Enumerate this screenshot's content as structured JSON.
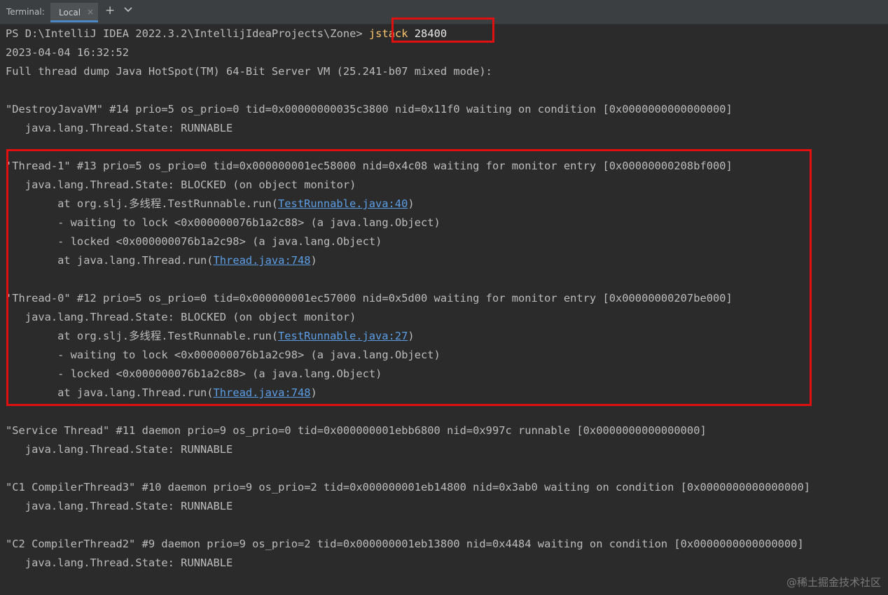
{
  "tabbar": {
    "title": "Terminal:",
    "tab_label": "Local",
    "tab_close": "×",
    "add_label": "+"
  },
  "terminal": {
    "prompt": "PS D:\\IntelliJ IDEA 2022.3.2\\IntellijIdeaProjects\\Zone> ",
    "command": "jstack",
    "command_arg": " 28400",
    "timestamp": "2023-04-04 16:32:52",
    "dump_header": "Full thread dump Java HotSpot(TM) 64-Bit Server VM (25.241-b07 mixed mode):",
    "destroy_header": "\"DestroyJavaVM\" #14 prio=5 os_prio=0 tid=0x00000000035c3800 nid=0x11f0 waiting on condition [0x0000000000000000]",
    "destroy_state": "   java.lang.Thread.State: RUNNABLE",
    "t1_header": "'Thread-1\" #13 prio=5 os_prio=0 tid=0x000000001ec58000 nid=0x4c08 waiting for monitor entry [0x00000000208bf000]",
    "t1_state": "   java.lang.Thread.State: BLOCKED (on object monitor)",
    "t1_at1_pre": "        at org.slj.多线程.TestRunnable.run(",
    "t1_at1_link": "TestRunnable.java:40",
    "t1_at1_post": ")",
    "t1_wait": "        - waiting to lock <0x000000076b1a2c88> (a java.lang.Object)",
    "t1_lock": "        - locked <0x000000076b1a2c98> (a java.lang.Object)",
    "t1_at2_pre": "        at java.lang.Thread.run(",
    "t1_at2_link": "Thread.java:748",
    "t1_at2_post": ")",
    "t0_header": "'Thread-0\" #12 prio=5 os_prio=0 tid=0x000000001ec57000 nid=0x5d00 waiting for monitor entry [0x00000000207be000]",
    "t0_state": "   java.lang.Thread.State: BLOCKED (on object monitor)",
    "t0_at1_pre": "        at org.slj.多线程.TestRunnable.run(",
    "t0_at1_link": "TestRunnable.java:27",
    "t0_at1_post": ")",
    "t0_wait": "        - waiting to lock <0x000000076b1a2c98> (a java.lang.Object)",
    "t0_lock": "        - locked <0x000000076b1a2c88> (a java.lang.Object)",
    "t0_at2_pre": "        at java.lang.Thread.run(",
    "t0_at2_link": "Thread.java:748",
    "t0_at2_post": ")",
    "service_header": "\"Service Thread\" #11 daemon prio=9 os_prio=0 tid=0x000000001ebb6800 nid=0x997c runnable [0x0000000000000000]",
    "service_state": "   java.lang.Thread.State: RUNNABLE",
    "c1_header": "\"C1 CompilerThread3\" #10 daemon prio=9 os_prio=2 tid=0x000000001eb14800 nid=0x3ab0 waiting on condition [0x0000000000000000]",
    "c1_state": "   java.lang.Thread.State: RUNNABLE",
    "c2_header": "\"C2 CompilerThread2\" #9 daemon prio=9 os_prio=2 tid=0x000000001eb13800 nid=0x4484 waiting on condition [0x0000000000000000]",
    "c2_state": "   java.lang.Thread.State: RUNNABLE"
  },
  "watermark": "@稀土掘金技术社区",
  "colors": {
    "background": "#2b2b2b",
    "text": "#bcbcbc",
    "link": "#5c9ee6",
    "highlight_box": "#e01010",
    "command": "#ffc66d"
  }
}
